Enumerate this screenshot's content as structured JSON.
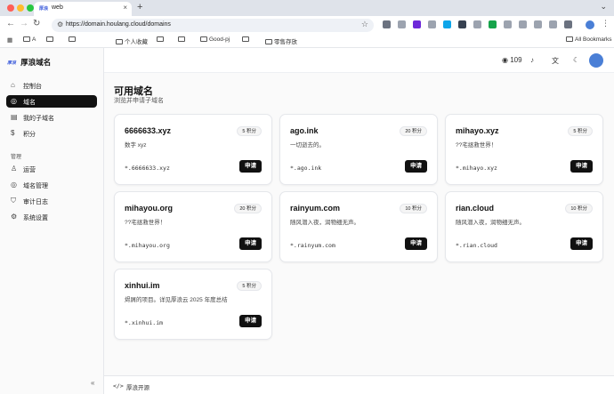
{
  "browser": {
    "tab_title": "web",
    "tab_favicon": "厚浪",
    "url": "https://domain.houlang.cloud/domains",
    "bookmarks": [
      {
        "label": "A"
      },
      {
        "label": ""
      },
      {
        "label": ""
      },
      {
        "label": "个人收藏"
      },
      {
        "label": ""
      },
      {
        "label": ""
      },
      {
        "label": "Good-pj"
      },
      {
        "label": ""
      },
      {
        "label": "零售存放"
      }
    ],
    "all_bookmarks": "All Bookmarks"
  },
  "app": {
    "logo": "厚浪",
    "name": "厚浪域名",
    "nav": [
      {
        "label": "控制台",
        "icon": "home-icon"
      },
      {
        "label": "域名",
        "icon": "globe-icon",
        "active": true
      },
      {
        "label": "我的子域名",
        "icon": "list-icon"
      },
      {
        "label": "积分",
        "icon": "coin-icon"
      }
    ],
    "admin_section": "管理",
    "admin_nav": [
      {
        "label": "运营",
        "icon": "user-icon"
      },
      {
        "label": "域名管理",
        "icon": "globe-icon"
      },
      {
        "label": "审计日志",
        "icon": "shield-icon"
      },
      {
        "label": "系统设置",
        "icon": "gear-icon"
      }
    ],
    "points": "109"
  },
  "page": {
    "title": "可用域名",
    "subtitle": "浏览并申请子域名"
  },
  "domains": [
    {
      "name": "6666633.xyz",
      "points": "5 积分",
      "desc": "数字 xyz",
      "wildcard": "*.6666633.xyz",
      "action": "申请"
    },
    {
      "name": "ago.ink",
      "points": "20 积分",
      "desc": "一切逝去的。",
      "wildcard": "*.ago.ink",
      "action": "申请"
    },
    {
      "name": "mihayo.xyz",
      "points": "5 积分",
      "desc": "??宅拯救世界！",
      "wildcard": "*.mihayo.xyz",
      "action": "申请"
    },
    {
      "name": "mihayou.org",
      "points": "20 积分",
      "desc": "??宅拯救世界！",
      "wildcard": "*.mihayou.org",
      "action": "申请"
    },
    {
      "name": "rainyum.com",
      "points": "10 积分",
      "desc": "随风潜入夜，润物细无声。",
      "wildcard": "*.rainyum.com",
      "action": "申请"
    },
    {
      "name": "rian.cloud",
      "points": "10 积分",
      "desc": "随风潜入夜，润物细无声。",
      "wildcard": "*.rian.cloud",
      "action": "申请"
    },
    {
      "name": "xinhui.im",
      "points": "5 积分",
      "desc": "烬屑的项目。详见厚浪云 2025 年度总结",
      "wildcard": "*.xinhui.im",
      "action": "申请"
    }
  ],
  "footer": {
    "text": "厚浪开源"
  },
  "colors": {
    "accent": "#111111",
    "chrome_bg": "#dfe3ea",
    "brand_blue": "#3b5bdb"
  }
}
